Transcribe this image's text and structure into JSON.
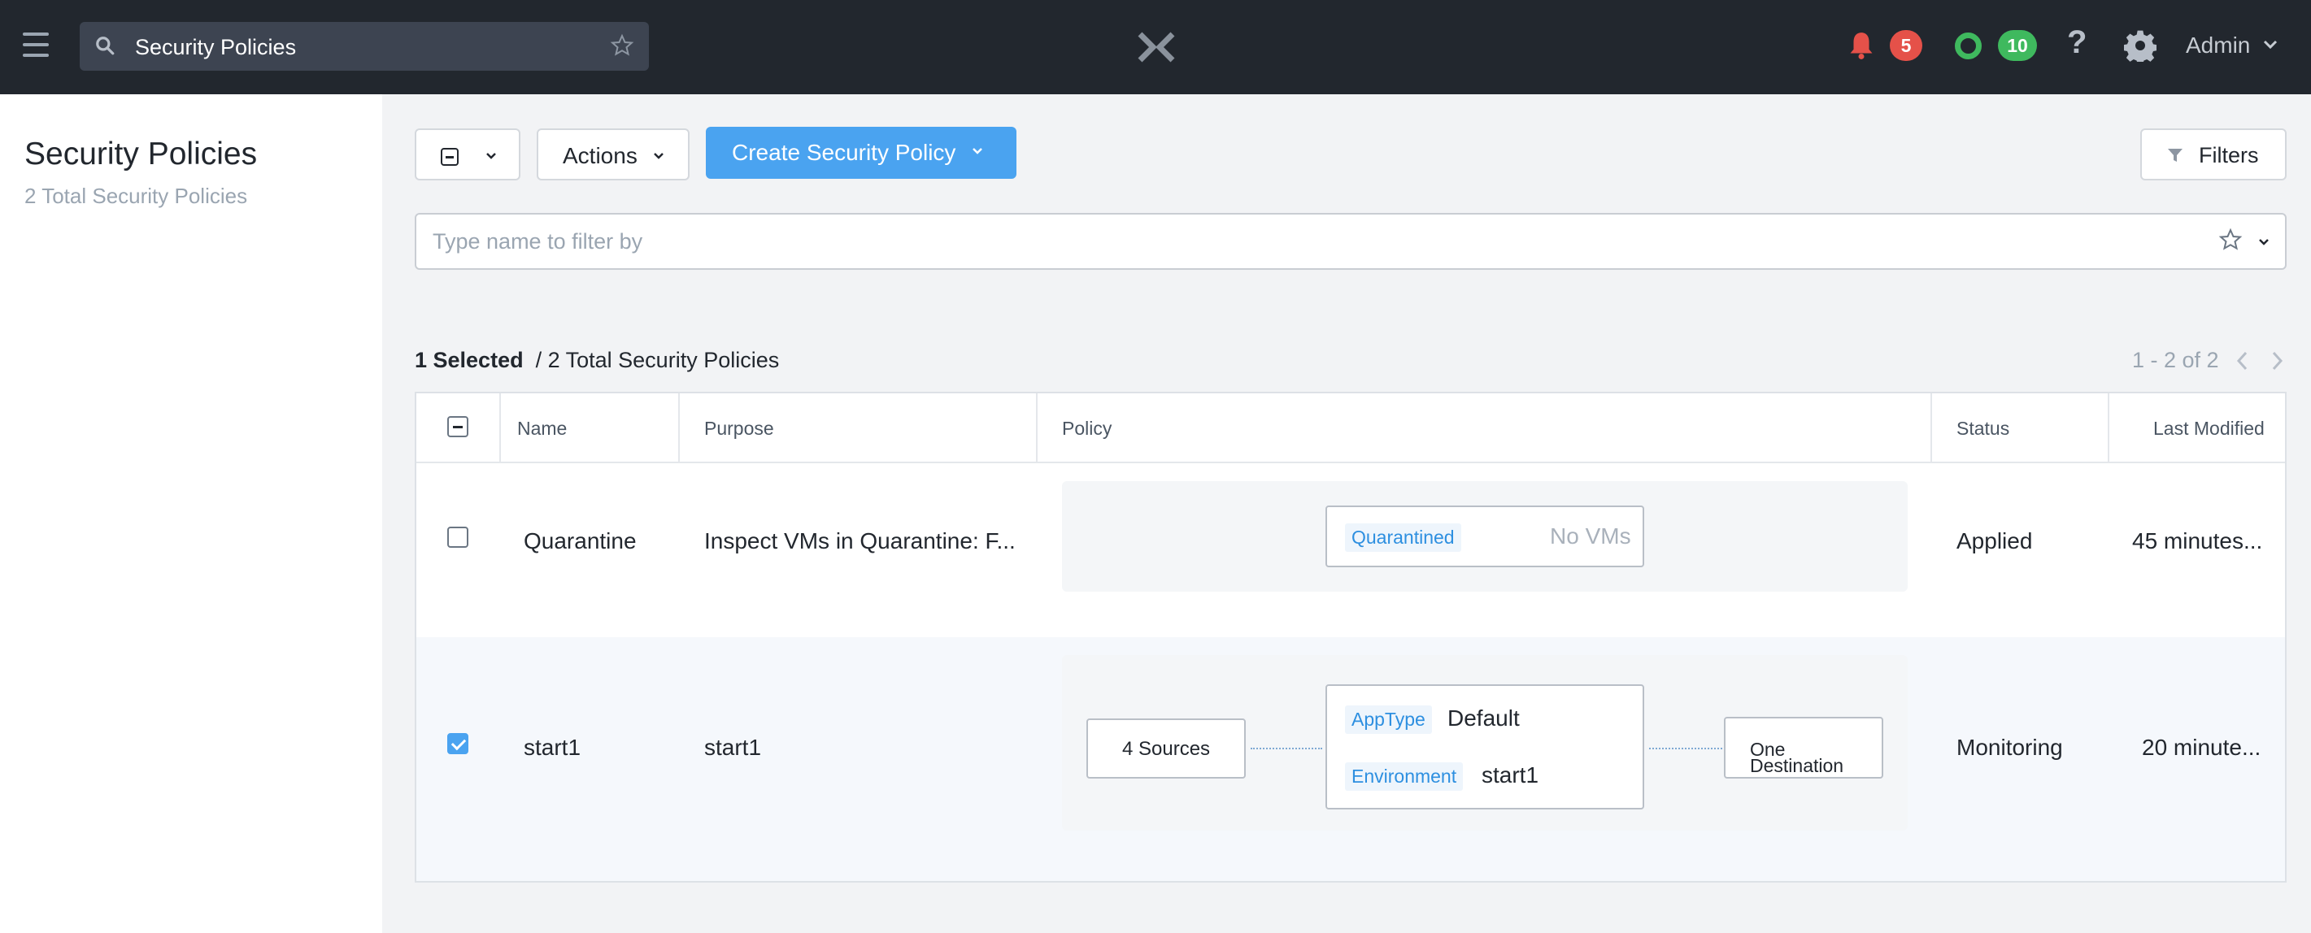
{
  "header": {
    "search_text": "Security Policies",
    "alert_count": "5",
    "ok_count": "10",
    "help_label": "?",
    "user": "Admin"
  },
  "sidebar": {
    "title": "Security Policies",
    "subtitle": "2 Total Security Policies"
  },
  "toolbar": {
    "actions_label": "Actions",
    "create_label": "Create Security Policy",
    "filters_label": "Filters",
    "filter_placeholder": "Type name to filter by"
  },
  "summary": {
    "selected": "1 Selected",
    "total": "/ 2 Total Security Policies",
    "pagination": "1 - 2 of 2"
  },
  "table": {
    "columns": [
      "Name",
      "Purpose",
      "Policy",
      "Status",
      "Last Modified"
    ],
    "rows": [
      {
        "checked": false,
        "name": "Quarantine",
        "purpose": "Inspect VMs in Quarantine: F...",
        "policy": {
          "tag": "Quarantined",
          "value": "No VMs"
        },
        "status": "Applied",
        "modified": "45 minutes..."
      },
      {
        "checked": true,
        "name": "start1",
        "purpose": "start1",
        "policy": {
          "sources": "4 Sources",
          "apptype_tag": "AppType",
          "apptype_value": "Default",
          "env_tag": "Environment",
          "env_value": "start1",
          "destination_line1": "One",
          "destination_line2": "Destination"
        },
        "status": "Monitoring",
        "modified": "20 minute..."
      }
    ]
  },
  "colors": {
    "nav_bg": "#22272e",
    "primary": "#4aa3f0",
    "alert": "#e55149",
    "ok": "#3fb95e"
  }
}
